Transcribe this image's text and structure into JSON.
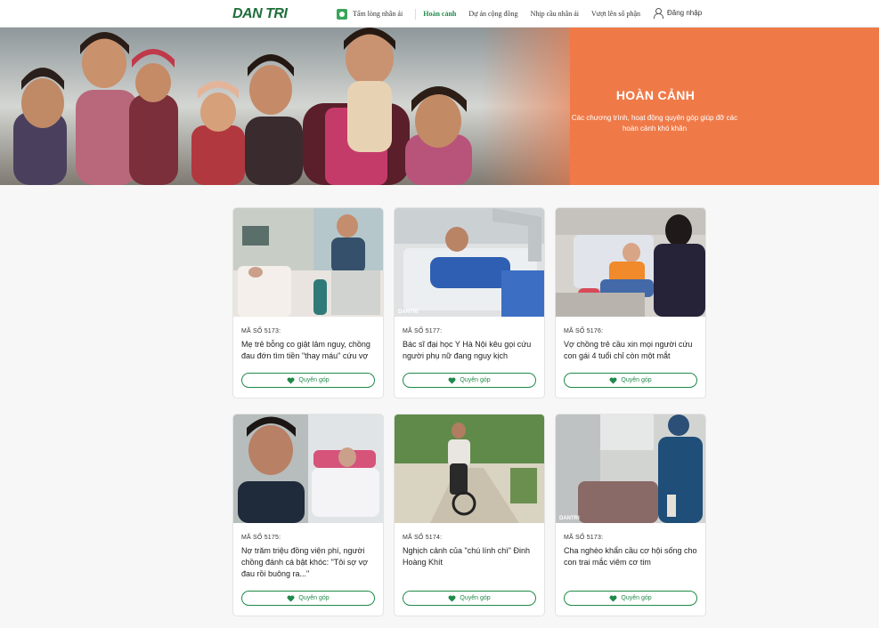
{
  "header": {
    "logo": "DAN TRI",
    "nav": [
      "Tấm lòng nhân ái",
      "Hoàn cảnh",
      "Dự án cộng đồng",
      "Nhịp cầu nhân ái",
      "Vượt lên số phận"
    ],
    "login": "Đăng nhập"
  },
  "hero": {
    "title": "HOÀN CẢNH",
    "subtitle": "Các chương trình, hoạt động quyên góp giúp đỡ các hoàn cảnh khó khăn"
  },
  "cards": [
    {
      "code": "MÃ SỐ 5173:",
      "title": "Mẹ trẻ bỗng co giật lâm nguy, chồng đau đớn tìm tiền \"thay máu\" cứu vợ",
      "button": "Quyên góp"
    },
    {
      "code": "MÃ SỐ 5177:",
      "title": "Bác sĩ đại học Y Hà Nội kêu gọi cứu người phụ nữ đang nguy kịch",
      "button": "Quyên góp"
    },
    {
      "code": "MÃ SỐ 5176:",
      "title": "Vợ chồng trẻ cầu xin mọi người cứu con gái 4 tuổi chỉ còn một mắt",
      "button": "Quyên góp"
    },
    {
      "code": "MÃ SỐ 5175:",
      "title": "Nợ trăm triệu đồng viện phí, người chồng đánh cá bật khóc: \"Tôi sợ vợ đau rồi buông ra...\"",
      "button": "Quyên góp"
    },
    {
      "code": "MÃ SỐ 5174:",
      "title": "Nghịch cảnh của \"chú lính chì\" Đinh Hoàng Khít",
      "button": "Quyên góp"
    },
    {
      "code": "MÃ SỐ 5173:",
      "title": "Cha nghèo khẩn cầu cơ hội sống cho con trai mắc viêm cơ tim",
      "button": "Quyên góp"
    }
  ],
  "colors": {
    "brand_green": "#1f8a49",
    "hero_orange": "#ef7a48"
  },
  "icons": [
    "tam-long-nhan-ai-icon",
    "user-icon",
    "heart-icon"
  ]
}
